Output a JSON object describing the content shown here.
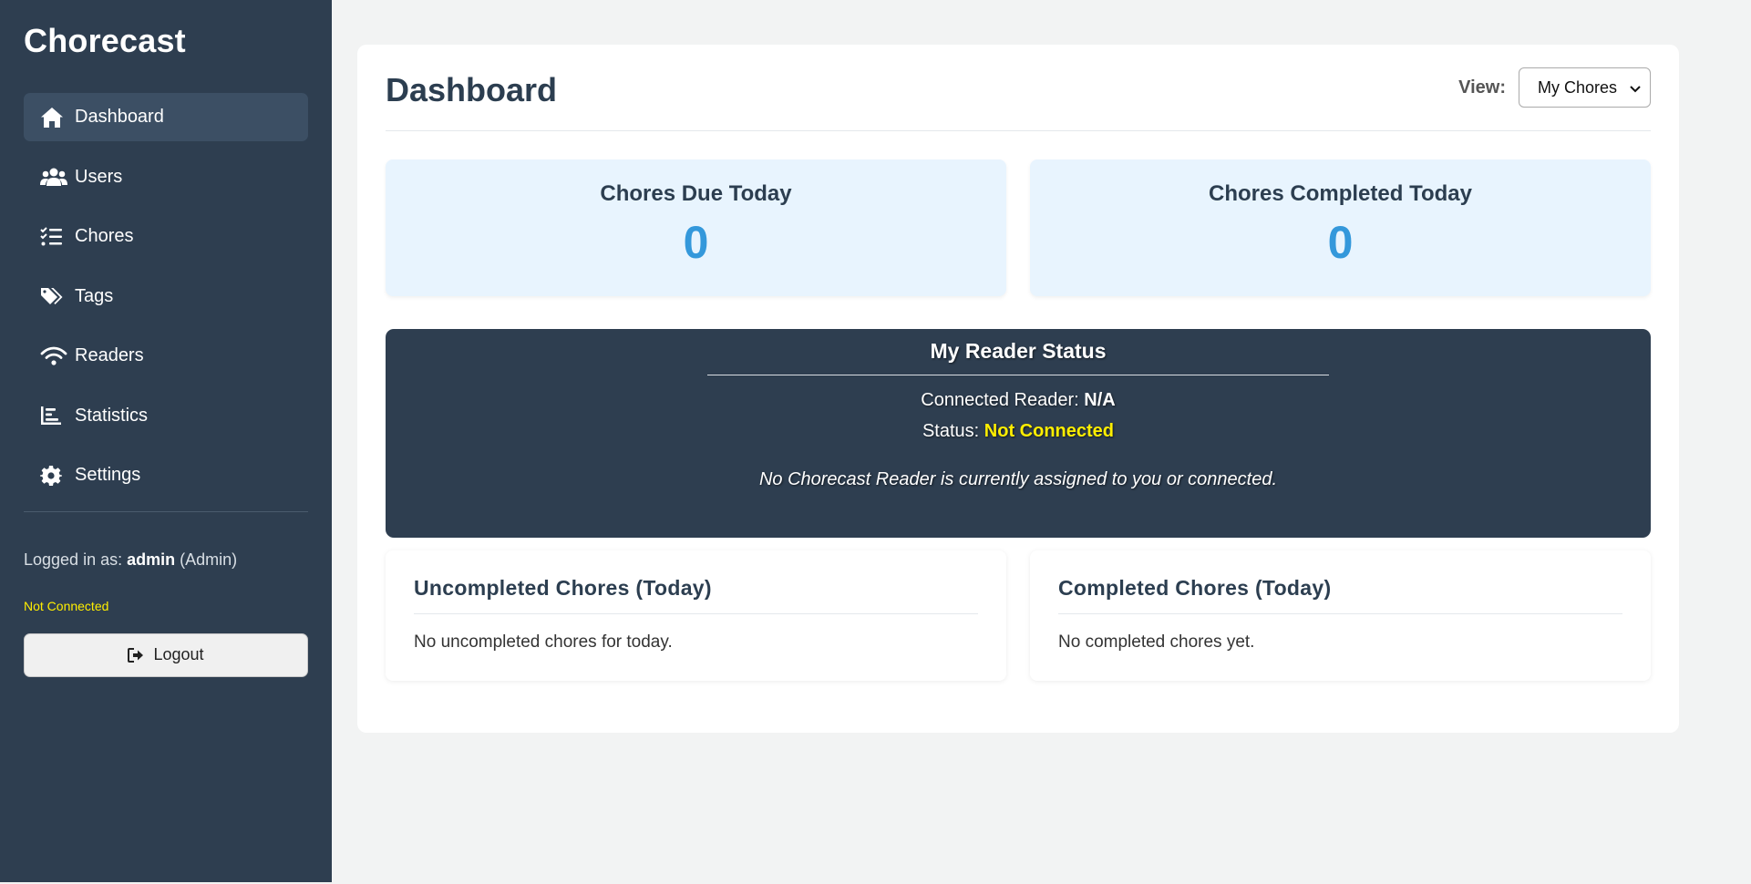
{
  "app": {
    "brand": "Chorecast"
  },
  "sidebar": {
    "items": [
      {
        "label": "Dashboard",
        "icon": "home-icon",
        "active": true
      },
      {
        "label": "Users",
        "icon": "users-icon"
      },
      {
        "label": "Chores",
        "icon": "list-check-icon"
      },
      {
        "label": "Tags",
        "icon": "tags-icon"
      },
      {
        "label": "Readers",
        "icon": "wifi-icon"
      },
      {
        "label": "Statistics",
        "icon": "bar-chart-icon"
      },
      {
        "label": "Settings",
        "icon": "gear-icon"
      }
    ],
    "logged_prefix": "Logged in as:",
    "username": "admin",
    "role": "(Admin)",
    "connection_status": "Not Connected",
    "logout_label": "Logout"
  },
  "header": {
    "title": "Dashboard",
    "view_label": "View:",
    "view_selected": "My Chores"
  },
  "stats": [
    {
      "title": "Chores Due Today",
      "value": "0"
    },
    {
      "title": "Chores Completed Today",
      "value": "0"
    }
  ],
  "reader": {
    "title": "My Reader Status",
    "connected_label": "Connected Reader:",
    "connected_value": "N/A",
    "status_label": "Status:",
    "status_value": "Not Connected",
    "note": "No Chorecast Reader is currently assigned to you or connected."
  },
  "lists": [
    {
      "title": "Uncompleted Chores (Today)",
      "empty": "No uncompleted chores for today."
    },
    {
      "title": "Completed Chores (Today)",
      "empty": "No completed chores yet."
    }
  ],
  "colors": {
    "sidebar_bg": "#2e3e50",
    "accent": "#3498db",
    "warning": "#ffee00",
    "stat_bg": "#e8f4fe"
  }
}
